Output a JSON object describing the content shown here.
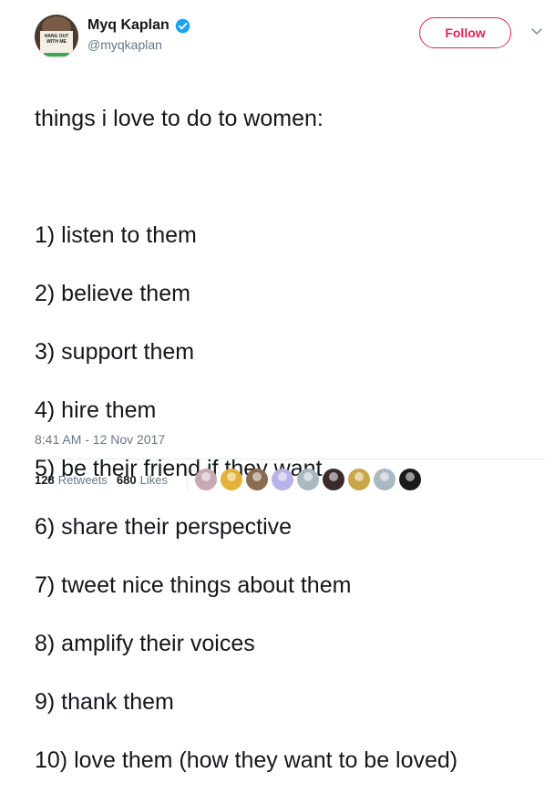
{
  "header": {
    "display_name": "Myq Kaplan",
    "handle": "@myqkaplan",
    "follow_label": "Follow",
    "avatar_sign_text": "HANG OUT WITH ME",
    "verified_color": "#1da1f2",
    "follow_color": "#e0245e"
  },
  "tweet": {
    "lines": [
      "things i love to do to women:",
      "",
      "1) listen to them",
      "2) believe them",
      "3) support them",
      "4) hire them",
      "5) be their friend if they want",
      "6) share their perspective",
      "7) tweet nice things about them",
      "8) amplify their voices",
      "9) thank them",
      "10) love them (how they want to be loved)"
    ],
    "timestamp": "8:41 AM - 12 Nov 2017"
  },
  "stats": {
    "retweets_count": "128",
    "retweets_label": "Retweets",
    "likes_count": "680",
    "likes_label": "Likes"
  },
  "likers": [
    {
      "name": "liker-avatar-1",
      "color": "#c7a9b4"
    },
    {
      "name": "liker-avatar-2",
      "color": "#e2b23a"
    },
    {
      "name": "liker-avatar-3",
      "color": "#8b6a4f"
    },
    {
      "name": "liker-avatar-4",
      "color": "#b9b2e8"
    },
    {
      "name": "liker-avatar-5",
      "color": "#aab8c2"
    },
    {
      "name": "liker-avatar-6",
      "color": "#3b2a2a"
    },
    {
      "name": "liker-avatar-7",
      "color": "#c9a64a"
    },
    {
      "name": "liker-avatar-8",
      "color": "#aab8c2"
    },
    {
      "name": "liker-avatar-9",
      "color": "#1a1a1a"
    }
  ]
}
